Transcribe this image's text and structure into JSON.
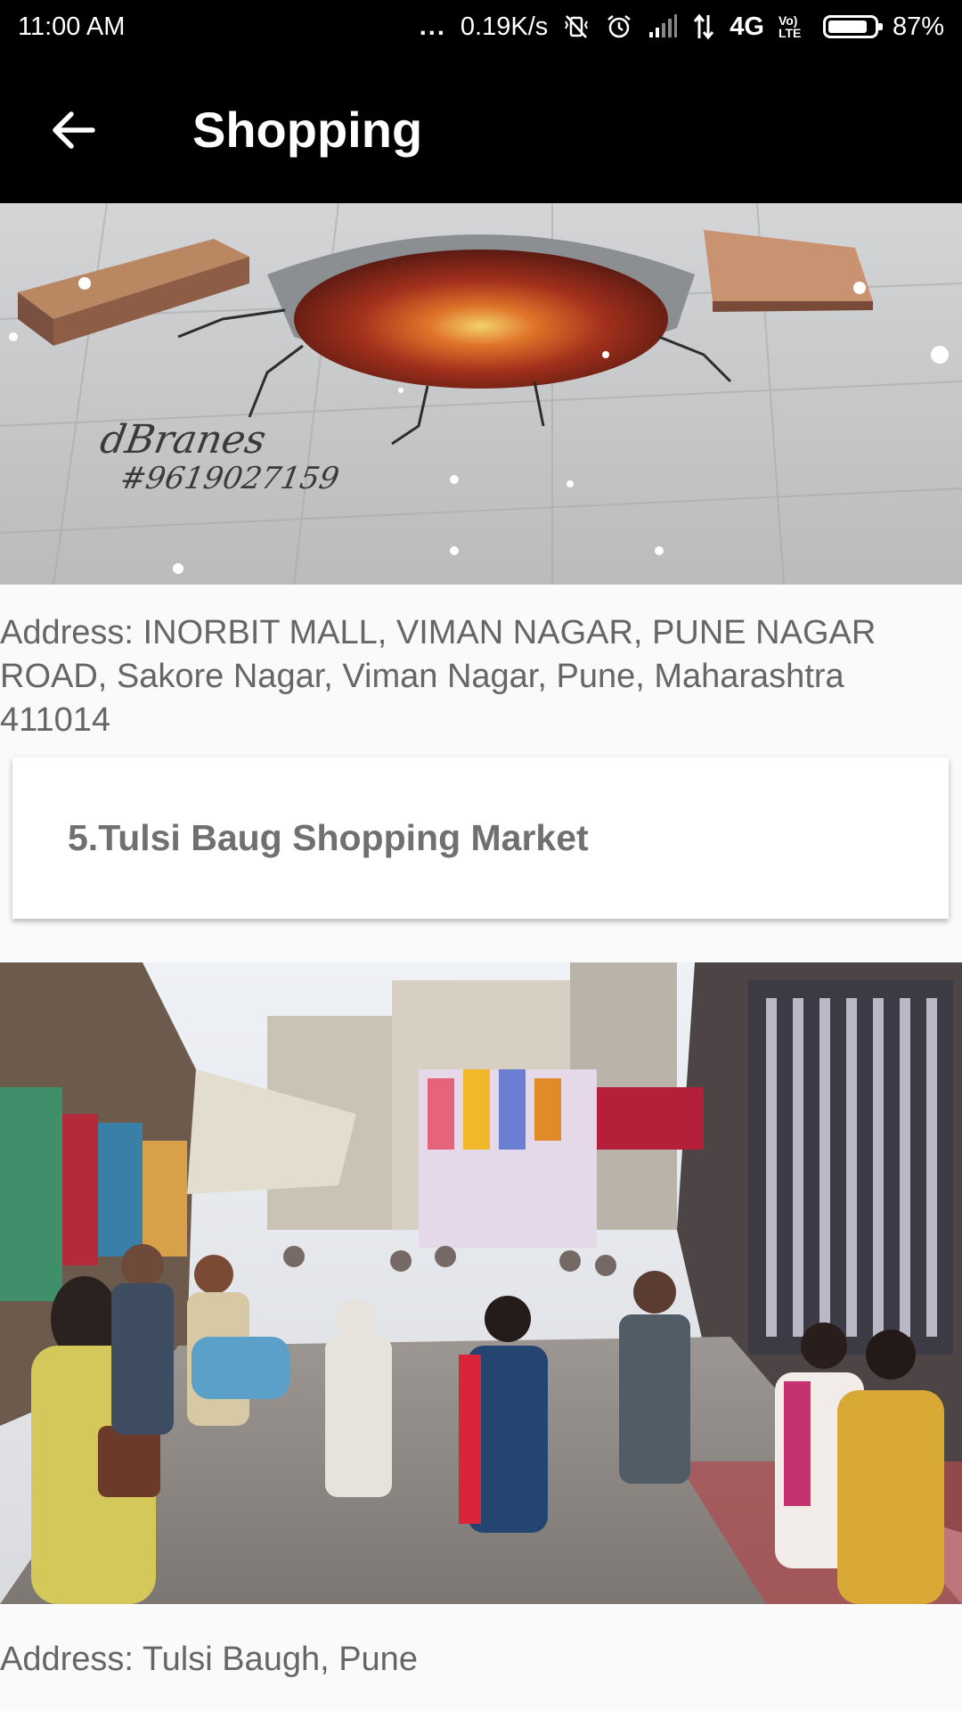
{
  "status_bar": {
    "time": "11:00 AM",
    "more": "...",
    "net_speed": "0.19K/s",
    "network_type": "4G",
    "volte": "Vo) LTE",
    "battery_percent": "87%",
    "battery_level": 0.87,
    "icons": [
      "vibrate-off-icon",
      "alarm-icon",
      "signal-icon",
      "data-arrows-icon",
      "battery-icon"
    ]
  },
  "app_bar": {
    "title": "Shopping",
    "back_icon": "arrow-back-icon"
  },
  "items": [
    {
      "image_watermark": "dBranes\n#9619027159",
      "address": "Address: INORBIT MALL, VIMAN NAGAR, PUNE NAGAR ROAD, Sakore Nagar, Viman Nagar, Pune, Maharashtra 411014"
    },
    {
      "title": "5.Tulsi Baug Shopping Market",
      "address": "Address: Tulsi Baugh, Pune"
    }
  ],
  "colors": {
    "app_bar": "#000000",
    "background": "#fafafa",
    "body_text": "#666666",
    "card_title": "#707070"
  }
}
